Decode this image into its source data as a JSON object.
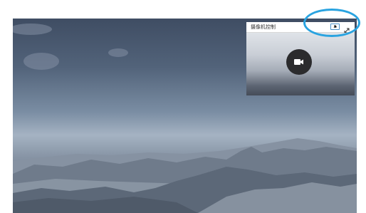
{
  "camera_panel": {
    "title": "摄像机控制",
    "pin_icon": "pin-icon",
    "expand_icon": "expand-icon",
    "camera_icon": "video-camera-icon"
  },
  "colors": {
    "highlight": "#29a3e0",
    "camera_circle": "#2b2b2d",
    "pin_border": "#4a90c8"
  }
}
